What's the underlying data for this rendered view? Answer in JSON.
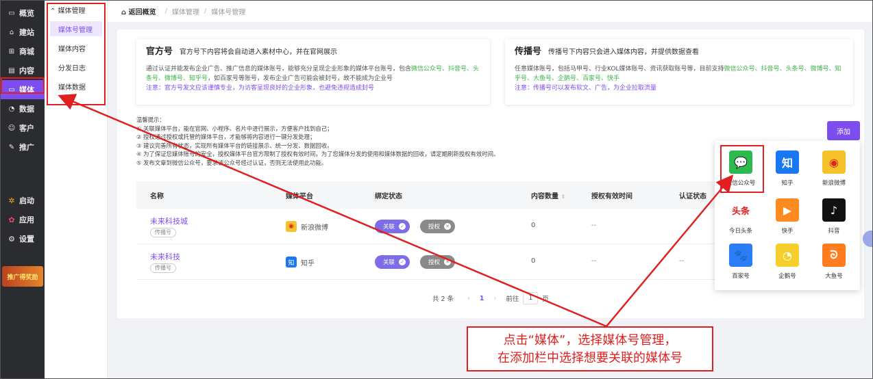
{
  "sidebar": {
    "items": [
      {
        "icon": "overview-icon",
        "label": "概览"
      },
      {
        "icon": "house-icon",
        "label": "建站"
      },
      {
        "icon": "cart-icon",
        "label": "商城"
      },
      {
        "icon": "document-icon",
        "label": "内容"
      },
      {
        "icon": "media-icon",
        "label": "媒体"
      },
      {
        "icon": "clock-icon",
        "label": "数据"
      },
      {
        "icon": "user-icon",
        "label": "客户"
      },
      {
        "icon": "promo-icon",
        "label": "推广"
      }
    ],
    "bottom": [
      {
        "icon": "launch-icon",
        "label": "启动"
      },
      {
        "icon": "apps-icon",
        "label": "应用"
      },
      {
        "icon": "gear-icon",
        "label": "设置"
      }
    ],
    "promo_text": "推广得奖励"
  },
  "submenu": {
    "title": "媒体管理",
    "items": [
      "媒体号管理",
      "媒体内容",
      "分发日志",
      "媒体数据"
    ]
  },
  "breadcrumb": {
    "home": "返回概览",
    "level1": "媒体管理",
    "level2": "媒体号管理"
  },
  "official": {
    "title": "官方号",
    "subtitle": "官方号下内容将会自动进入素材中心，并在官网展示",
    "desc_a": "通过认证并能发布企业广告、推广信息的媒体账号，能够充分呈现企业形象的媒体平台账号，包含",
    "desc_green_1": "微信公众号、抖音号、头条号、微博号、知乎号",
    "desc_b": "，如百家号等账号，发布企业广告可能会被封号，故不能成为企业号",
    "note": "注意：官方号发文应该谨慎专业，为访客呈现良好的企业形象，也避免违规造成封号"
  },
  "broadcast": {
    "title": "传播号",
    "subtitle": "传播号下内容只会进入媒体内容，并提供数据查看",
    "desc_a": "任意媒体账号，包括马甲号、行业KOL媒体账号、资讯获取账号等，目前支持",
    "desc_green_1": "微信公众号、抖音号、头条号、微博号、知乎号、大鱼号、企鹅号、百家号、快手",
    "note": "注意：传播号可以发布软文、广告，为企业拉取流量"
  },
  "tips": {
    "title": "温馨提示：",
    "lines": [
      "① 关联媒体平台，能在官网、小程序、名片中进行展示，方便客户找到自己；",
      "② 授权通过授权或托管的媒体平台，才能够将内容进行一键分发处理；",
      "③ 建议完善所有状态，实现所有媒体平台的链接展示、统一分发、数据回收。",
      "④ 为了保证您媒体账号的安全，授权媒体平台官方限制了授权有效时间，为了您媒体分发的使用和媒体数据的回收，请定期刷新授权有效时间。",
      "⑤ 发布文章到微信公众号，要求该公众号经过认证，否则无法使用此功能。"
    ]
  },
  "add_button": "添加",
  "table": {
    "headers": [
      "名称",
      "媒体平台",
      "绑定状态",
      "内容数量",
      "授权有效时间",
      "认证状态"
    ],
    "rows": [
      {
        "name": "未来科技城",
        "tag": "传播号",
        "platform": "新浪微博",
        "platform_icon": "weibo-icon",
        "bind": "关联",
        "auth": "授权",
        "count": "0",
        "expire": "--",
        "cert": ""
      },
      {
        "name": "未来科技",
        "tag": "传播号",
        "platform": "知乎",
        "platform_icon": "zhihu-icon",
        "bind": "关联",
        "auth": "授权",
        "count": "0",
        "expire": "--",
        "cert": "--"
      }
    ]
  },
  "pagination": {
    "total": "共 2 条",
    "prev": "‹",
    "current": "1",
    "next": "›",
    "goto": "前往",
    "goto_value": "1",
    "page_unit": "页"
  },
  "dropdown": {
    "platforms": [
      {
        "label": "微信公众号",
        "icon": "wechat-icon",
        "glyph": "💬",
        "color": "#2cb94f"
      },
      {
        "label": "知乎",
        "icon": "zhihu-icon",
        "glyph": "知",
        "color": "#1778f2"
      },
      {
        "label": "新浪微博",
        "icon": "weibo-icon",
        "glyph": "◉",
        "color": "#f6c22b"
      },
      {
        "label": "今日头条",
        "icon": "toutiao-icon",
        "glyph": "头条",
        "color": "#ffffff"
      },
      {
        "label": "快手",
        "icon": "kuaishou-icon",
        "glyph": "▶",
        "color": "#ff8a1f"
      },
      {
        "label": "抖音",
        "icon": "douyin-icon",
        "glyph": "♪",
        "color": "#111111"
      },
      {
        "label": "百家号",
        "icon": "baijiahao-icon",
        "glyph": "🐾",
        "color": "#2b7cf5"
      },
      {
        "label": "企鹅号",
        "icon": "qie-icon",
        "glyph": "◔",
        "color": "#f7cf2d"
      },
      {
        "label": "大鱼号",
        "icon": "dayu-icon",
        "glyph": "ᘐ",
        "color": "#ff7d1f"
      }
    ]
  },
  "annotation": {
    "line1": "点击“媒体”，选择媒体号管理，",
    "line2": "在添加栏中选择想要关联的媒体号"
  },
  "colors": {
    "accent": "#7d4df0",
    "annotation": "#e02020",
    "sidebar": "#2b2c30"
  }
}
